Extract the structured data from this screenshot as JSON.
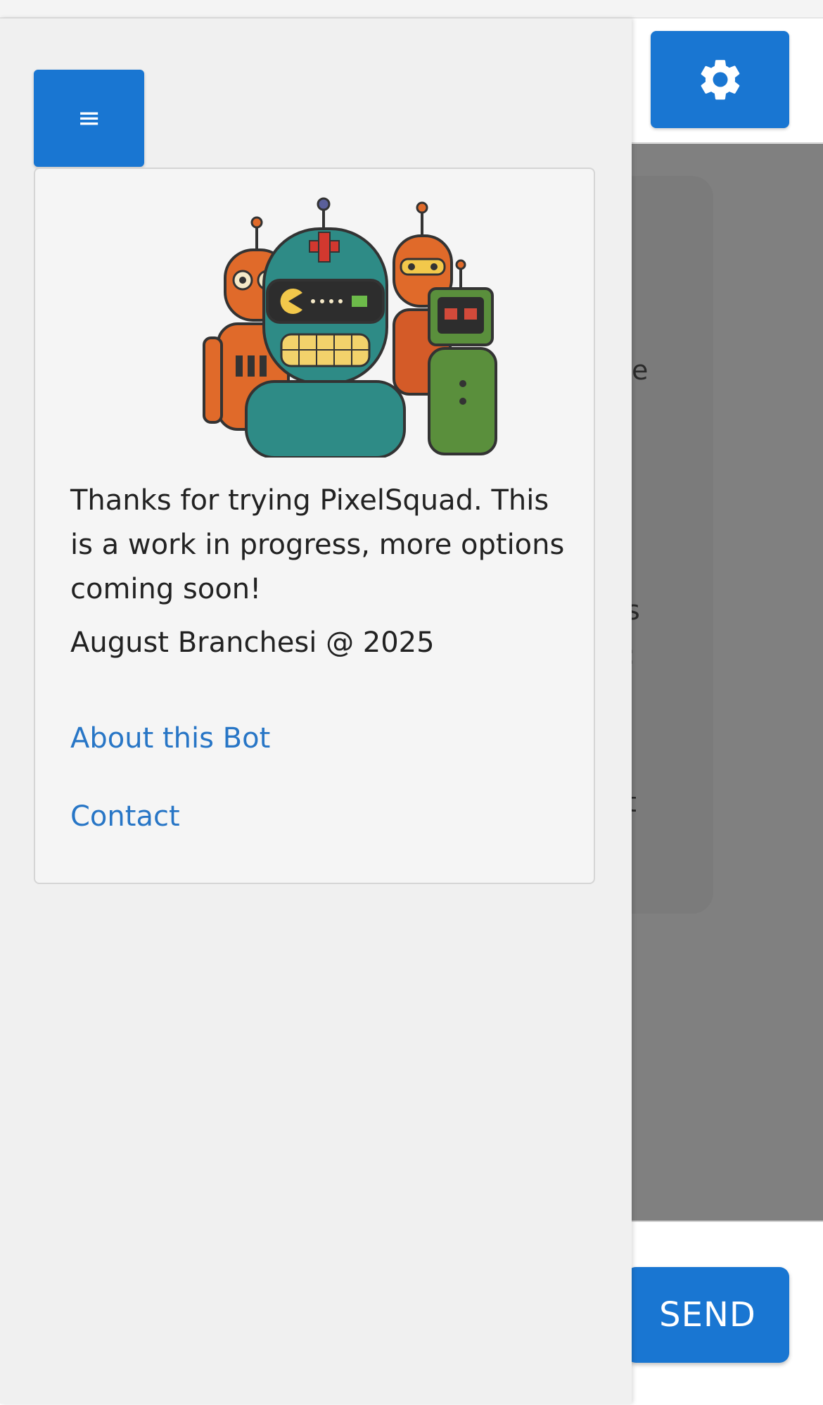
{
  "header": {
    "settings_icon": "gear-icon"
  },
  "chat": {
    "visible_fragments": [
      "e",
      "s",
      ":",
      "t"
    ]
  },
  "input_bar": {
    "send_label": "SEND"
  },
  "drawer": {
    "menu_label": "≡",
    "card": {
      "illustration": "robot-group-illustration",
      "message": "Thanks for trying PixelSquad. This is a work in progress, more options coming soon!",
      "copyright": "August Branchesi @ 2025",
      "links": {
        "about": "About this Bot",
        "contact": "Contact"
      }
    }
  },
  "colors": {
    "primary": "#1976d2",
    "link": "#2876c6",
    "overlay": "#808080",
    "drawer_bg": "#f0f0f0"
  }
}
